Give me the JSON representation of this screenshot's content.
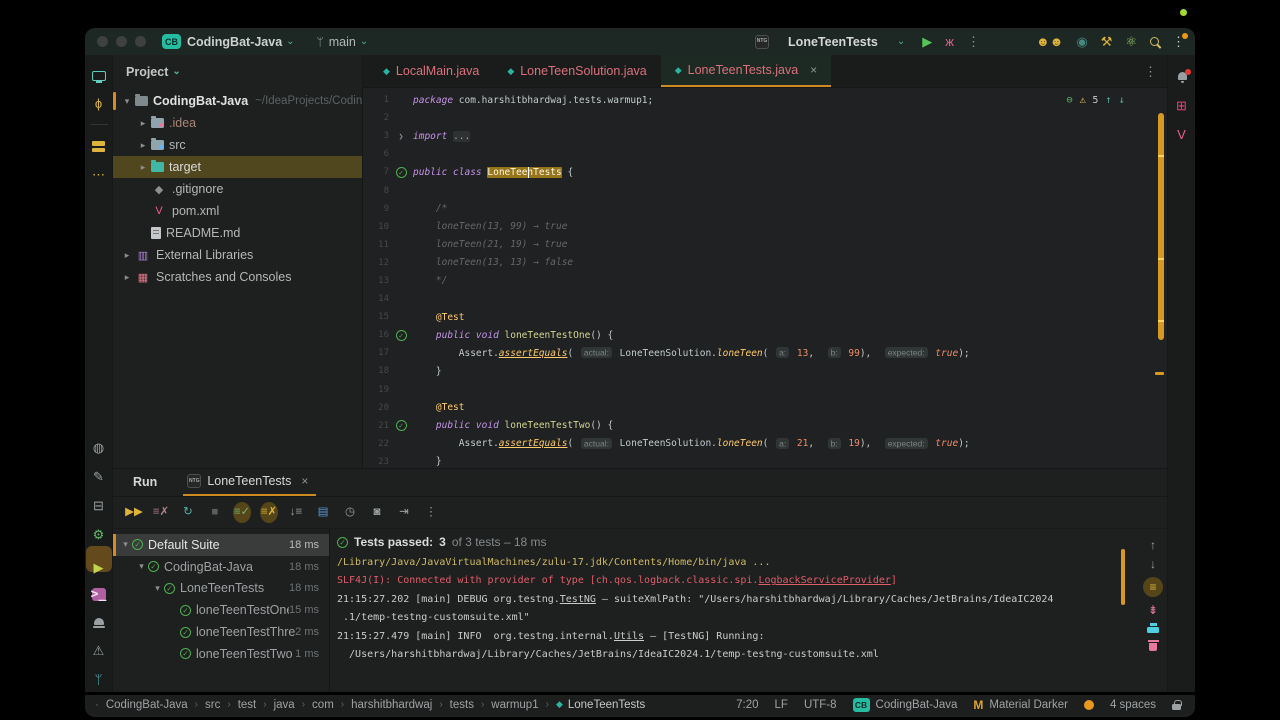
{
  "titlebar": {
    "traffic_lights": [
      "#3e4140",
      "#3e4140",
      "#3e4140"
    ],
    "project_badge": "CB",
    "project_name": "CodingBat-Java",
    "chevron": "⌄",
    "branch_glyph": "ᛘ",
    "branch_name": "main",
    "run_config_icon": "NTG",
    "run_config_name": "LoneTeenTests",
    "recording_dot_color": "#a6d930",
    "action_icons": [
      {
        "name": "run-button",
        "glyph": "▶",
        "color": "#57c457"
      },
      {
        "name": "debug-bug-icon",
        "glyph": "ж",
        "color": "#df5e8a"
      },
      {
        "name": "more-run-actions-icon",
        "glyph": "⋮",
        "color": "#8e9294"
      },
      {
        "name": "spacer",
        "spacer": 30
      },
      {
        "name": "code-with-me-users-icon",
        "glyph": "☻☻",
        "color": "#ddb33c"
      },
      {
        "name": "profiler-record-icon",
        "glyph": "◉",
        "color": "#44887e"
      },
      {
        "name": "build-tools-icon",
        "glyph": "⚒",
        "color": "#ddb33c"
      },
      {
        "name": "science-atom-icon",
        "glyph": "⚛",
        "color": "#9ccc65"
      },
      {
        "name": "search-everywhere-icon",
        "glyph": "",
        "css": "search",
        "color": "#d5ba62"
      },
      {
        "name": "settings-more-icon",
        "glyph": "⋮",
        "color": "#c9cccd",
        "badge": "#e8981c"
      }
    ]
  },
  "left_stripe_top": [
    {
      "name": "project-tool-icon",
      "glyph": "",
      "css": "monitor",
      "active": true
    },
    {
      "name": "commit-tool-icon",
      "glyph": "ϕ",
      "color": "#d9b23c"
    },
    {
      "name": "divider",
      "divider": true
    },
    {
      "name": "structure-tool-icon",
      "glyph": "",
      "css": "stack"
    },
    {
      "name": "more-tool-windows-icon",
      "glyph": "⋯",
      "color": "#d9b23c"
    }
  ],
  "left_stripe_bottom": [
    {
      "name": "circle-squiggle-icon",
      "glyph": "◍",
      "color": "#9aa0a2"
    },
    {
      "name": "pen-tool-icon",
      "glyph": "✎",
      "color": "#9aa0a2"
    },
    {
      "name": "services-tool-icon",
      "glyph": "⊟",
      "color": "#9aa0a2"
    },
    {
      "name": "settings-gear-icon",
      "glyph": "⚙",
      "color": "#66bb6a"
    },
    {
      "name": "run-tool-icon",
      "glyph": "▶",
      "color": "#c3d34b",
      "activebox": true
    },
    {
      "name": "terminal-tool-icon",
      "glyph": ">_",
      "css": "terminal"
    },
    {
      "name": "alert-lamp-icon",
      "glyph": "",
      "css": "bell-lamp"
    },
    {
      "name": "problems-warning-icon",
      "glyph": "⚠",
      "color": "#9aa0a2"
    },
    {
      "name": "git-branch-tool-icon",
      "glyph": "ᛘ",
      "color": "#4fb3bf"
    }
  ],
  "right_stripe": [
    {
      "name": "notifications-bell-icon",
      "glyph": "",
      "css": "bell",
      "badge": "#e53935"
    },
    {
      "name": "dependencies-plus-icon",
      "glyph": "⊞",
      "color": "#ec407a"
    },
    {
      "name": "maven-tool-icon",
      "glyph": "V",
      "color": "#ec5f8a"
    }
  ],
  "project_panel": {
    "title": "Project",
    "chevron": "⌄",
    "items": [
      {
        "label": "CodingBat-Java",
        "path": "~/IdeaProjects/CodingBat",
        "indent": 0,
        "chevron": "▾",
        "icon": "folder-root",
        "bold": true,
        "focused": true,
        "color": "#e0e2e1"
      },
      {
        "label": ".idea",
        "indent": 1,
        "chevron": "▸",
        "icon": "folder-idea",
        "color": "#a98478"
      },
      {
        "label": "src",
        "indent": 1,
        "chevron": "▸",
        "icon": "folder-src"
      },
      {
        "label": "target",
        "indent": 1,
        "chevron": "▸",
        "icon": "folder-target",
        "selected": true,
        "color": "#d8dadb"
      },
      {
        "label": ".gitignore",
        "indent": 1,
        "glyph": "◆",
        "glyph_color": "#8a8f91"
      },
      {
        "label": "pom.xml",
        "indent": 1,
        "glyph": "V",
        "glyph_color": "#ef5d8a"
      },
      {
        "label": "README.md",
        "indent": 1,
        "icon": "doc"
      },
      {
        "label": "External Libraries",
        "indent": 0,
        "chevron": "▸",
        "glyph": "▥",
        "glyph_color": "#b085d6"
      },
      {
        "label": "Scratches and Consoles",
        "indent": 0,
        "chevron": "▸",
        "glyph": "▦",
        "glyph_color": "#e57a8d"
      }
    ]
  },
  "editor": {
    "tabs": [
      {
        "label": "LocalMain.java"
      },
      {
        "label": "LoneTeenSolution.java"
      },
      {
        "label": "LoneTeenTests.java",
        "active": true,
        "close": "×"
      }
    ],
    "tabs_more_icon": "⋮",
    "inspections": {
      "ok": "⊖",
      "warn": "⚠",
      "count": "5",
      "up": "↑",
      "down": "↓"
    },
    "lines": [
      {
        "n": "1",
        "seg": [
          [
            "kw",
            "package"
          ],
          [
            "pl",
            " com.harshitbhardwaj.tests.warmup1;"
          ]
        ]
      },
      {
        "n": "2",
        "seg": []
      },
      {
        "n": "3",
        "gut": "fold",
        "seg": [
          [
            "kw",
            "import"
          ],
          [
            "pl",
            " "
          ],
          [
            "fold",
            "..."
          ]
        ]
      },
      {
        "n": "6",
        "seg": []
      },
      {
        "n": "7",
        "gut": "check",
        "seg": [
          [
            "kw",
            "public class"
          ],
          [
            "pl",
            " "
          ],
          [
            "hl",
            "LoneTeenTests"
          ],
          [
            "pl",
            " {"
          ]
        ]
      },
      {
        "n": "8",
        "seg": []
      },
      {
        "n": "9",
        "seg": [
          [
            "cmt",
            "    /*"
          ]
        ]
      },
      {
        "n": "10",
        "seg": [
          [
            "cmt",
            "    loneTeen(13, 99) → true"
          ]
        ]
      },
      {
        "n": "11",
        "seg": [
          [
            "cmt",
            "    loneTeen(21, 19) → true"
          ]
        ]
      },
      {
        "n": "12",
        "seg": [
          [
            "cmt",
            "    loneTeen(13, 13) → false"
          ]
        ]
      },
      {
        "n": "13",
        "seg": [
          [
            "cmt",
            "    */"
          ]
        ]
      },
      {
        "n": "14",
        "seg": []
      },
      {
        "n": "15",
        "seg": [
          [
            "ann",
            "    @Test"
          ]
        ]
      },
      {
        "n": "16",
        "gut": "check",
        "seg": [
          [
            "kw",
            "    public void"
          ],
          [
            "mthd",
            " loneTeenTestOne"
          ],
          [
            "pl",
            "() {"
          ]
        ]
      },
      {
        "n": "17",
        "seg": [
          [
            "pl",
            "        Assert."
          ],
          [
            "mthu",
            "assertEquals"
          ],
          [
            "pl",
            "( "
          ],
          [
            "hint",
            "actual:"
          ],
          [
            "pl",
            " LoneTeenSolution."
          ],
          [
            "mth",
            "loneTeen"
          ],
          [
            "pl",
            "( "
          ],
          [
            "hint",
            "a:"
          ],
          [
            "num",
            " 13"
          ],
          [
            "pl",
            ",  "
          ],
          [
            "hint",
            "b:"
          ],
          [
            "num",
            " 99"
          ],
          [
            "pl",
            "),  "
          ],
          [
            "hint",
            "expected:"
          ],
          [
            "bool",
            " true"
          ],
          [
            "pl",
            ");"
          ]
        ]
      },
      {
        "n": "18",
        "seg": [
          [
            "pl",
            "    }"
          ]
        ]
      },
      {
        "n": "19",
        "seg": []
      },
      {
        "n": "20",
        "seg": [
          [
            "ann",
            "    @Test"
          ]
        ]
      },
      {
        "n": "21",
        "gut": "check",
        "seg": [
          [
            "kw",
            "    public void"
          ],
          [
            "mthd",
            " loneTeenTestTwo"
          ],
          [
            "pl",
            "() {"
          ]
        ]
      },
      {
        "n": "22",
        "seg": [
          [
            "pl",
            "        Assert."
          ],
          [
            "mthu",
            "assertEquals"
          ],
          [
            "pl",
            "( "
          ],
          [
            "hint",
            "actual:"
          ],
          [
            "pl",
            " LoneTeenSolution."
          ],
          [
            "mth",
            "loneTeen"
          ],
          [
            "pl",
            "( "
          ],
          [
            "hint",
            "a:"
          ],
          [
            "num",
            " 21"
          ],
          [
            "pl",
            ",  "
          ],
          [
            "hint",
            "b:"
          ],
          [
            "num",
            " 19"
          ],
          [
            "pl",
            "),  "
          ],
          [
            "hint",
            "expected:"
          ],
          [
            "bool",
            " true"
          ],
          [
            "pl",
            ");"
          ]
        ]
      },
      {
        "n": "23",
        "seg": [
          [
            "pl",
            "    }"
          ]
        ]
      }
    ]
  },
  "run_panel": {
    "label": "Run",
    "tab": {
      "icon": "NTG",
      "label": "LoneTeenTests",
      "close": "×"
    },
    "toolbar": [
      {
        "name": "rerun-tests-icon",
        "glyph": "▶▶",
        "color": "#ddb33c"
      },
      {
        "name": "rerun-failed-tests-icon",
        "glyph": "≡✗",
        "color": "#b08084"
      },
      {
        "name": "toggle-auto-rerun-icon",
        "glyph": "↻",
        "color": "#57b3a5"
      },
      {
        "name": "stop-icon",
        "glyph": "■",
        "color": "#5a5e5f"
      },
      {
        "name": "show-passed-toggle-icon",
        "glyph": "≡✓",
        "color": "#72b56a",
        "circled": true
      },
      {
        "name": "show-skipped-toggle-icon",
        "glyph": "≡✗",
        "color": "#ddb33c",
        "circled": true
      },
      {
        "name": "sort-by-duration-icon",
        "glyph": "↓≡",
        "color": "#9aa0a2"
      },
      {
        "name": "import-test-results-icon",
        "glyph": "▤",
        "color": "#5b9bd5"
      },
      {
        "name": "test-history-icon",
        "glyph": "◷",
        "color": "#9aa0a2"
      },
      {
        "name": "screenshot-camera-icon",
        "glyph": "◙",
        "color": "#9aa0a2"
      },
      {
        "name": "export-results-icon",
        "glyph": "⇥",
        "color": "#9aa0a2"
      },
      {
        "name": "more-options-icon",
        "glyph": "⋮",
        "color": "#9aa0a2"
      }
    ],
    "tests": [
      {
        "label": "Default Suite",
        "time": "18 ms",
        "indent": 0,
        "chevron": "▾",
        "selected": true
      },
      {
        "label": "CodingBat-Java",
        "time": "18 ms",
        "indent": 1,
        "chevron": "▾"
      },
      {
        "label": "LoneTeenTests",
        "time": "18 ms",
        "indent": 2,
        "chevron": "▾"
      },
      {
        "label": "loneTeenTestOne",
        "time": "15 ms",
        "indent": 3
      },
      {
        "label": "loneTeenTestThree",
        "time": "2 ms",
        "indent": 3
      },
      {
        "label": "loneTeenTestTwo",
        "time": "1 ms",
        "indent": 3
      }
    ],
    "summary": {
      "check": "✓",
      "strong": "Tests passed:",
      "count": "3",
      "rest": "of 3 tests – 18 ms"
    },
    "console_lines": [
      {
        "parts": [
          [
            "y",
            "/Library/Java/JavaVirtualMachines/zulu-17.jdk/Contents/Home/bin/java ..."
          ]
        ]
      },
      {
        "parts": [
          [
            "r",
            "SLF4J(I): Connected with provider of type [ch.qos.logback.classic.spi."
          ],
          [
            "rl",
            "LogbackServiceProvider"
          ],
          [
            "r",
            "]"
          ]
        ]
      },
      {
        "parts": [
          [
            "w",
            "21:15:27.202 [main] DEBUG org.testng."
          ],
          [
            "wl",
            "TestNG"
          ],
          [
            "w",
            " – suiteXmlPath: \"/Users/harshitbhardwaj/Library/Caches/JetBrains/IdeaIC2024"
          ]
        ]
      },
      {
        "parts": [
          [
            "w",
            " .1/temp-testng-customsuite.xml\""
          ]
        ]
      },
      {
        "parts": [
          [
            "w",
            "21:15:27.479 [main] INFO  org.testng.internal."
          ],
          [
            "wl",
            "Utils"
          ],
          [
            "w",
            " – [TestNG] Running:"
          ]
        ]
      },
      {
        "parts": [
          [
            "w",
            "  /Users/harshitbhardwaj/Library/Caches/JetBrains/IdeaIC2024.1/temp-testng-customsuite.xml"
          ]
        ]
      }
    ],
    "console_icons": [
      {
        "name": "scroll-up-icon",
        "glyph": "↑",
        "color": "#9aa0a2"
      },
      {
        "name": "scroll-down-icon",
        "glyph": "↓",
        "color": "#9aa0a2"
      },
      {
        "name": "soft-wrap-toggle-icon",
        "glyph": "≡",
        "color": "#d9b23c",
        "circled": true
      },
      {
        "name": "scroll-to-end-icon",
        "glyph": "⇟",
        "color": "#e57a9e"
      },
      {
        "name": "print-icon",
        "glyph": "",
        "css": "printer",
        "color": "#4dd0e1"
      },
      {
        "name": "clear-console-icon",
        "glyph": "",
        "css": "trash",
        "color": "#e57a9e"
      }
    ]
  },
  "status_bar": {
    "dot": "·",
    "breadcrumbs": [
      "CodingBat-Java",
      "src",
      "test",
      "java",
      "com",
      "harshitbhardwaj",
      "tests",
      "warmup1"
    ],
    "breadcrumb_last": "LoneTeenTests",
    "separator": "›",
    "caret_position": "7:20",
    "line_ending": "LF",
    "encoding": "UTF-8",
    "project_badge": "CB",
    "project_name": "CodingBat-Java",
    "theme_badge": "M",
    "theme_name": "Material Darker",
    "indent_setting": "4 spaces"
  }
}
